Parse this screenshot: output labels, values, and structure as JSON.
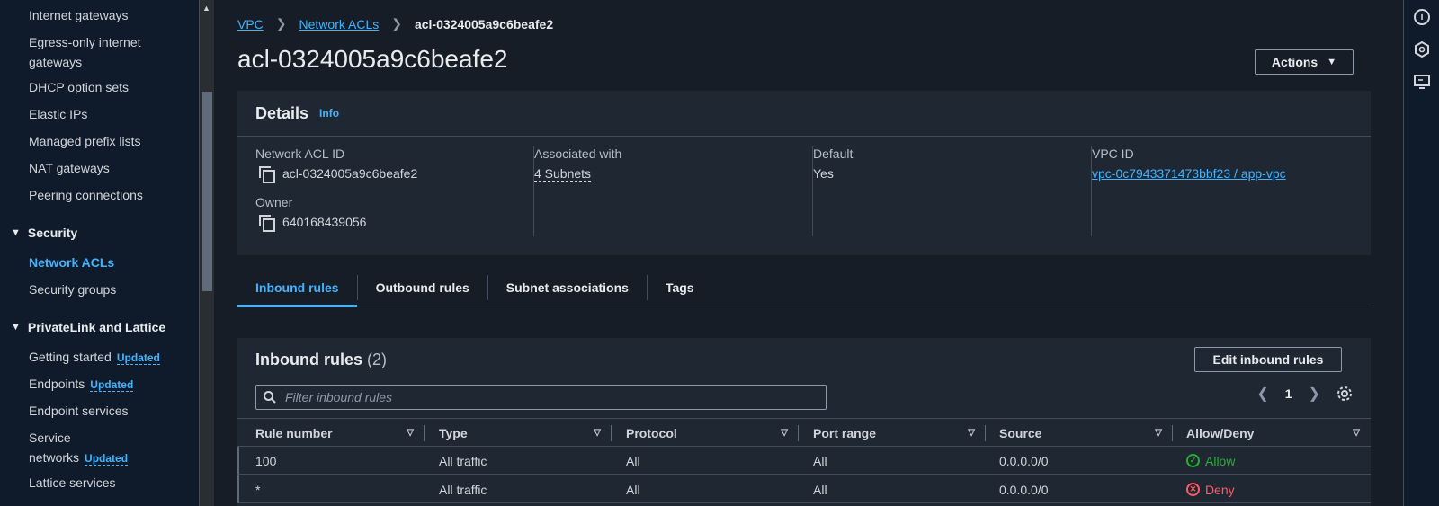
{
  "sidebar": {
    "items_top": [
      {
        "label": "Internet gateways"
      },
      {
        "label": "Egress-only internet gateways"
      },
      {
        "label": "DHCP option sets"
      },
      {
        "label": "Elastic IPs"
      },
      {
        "label": "Managed prefix lists"
      },
      {
        "label": "NAT gateways"
      },
      {
        "label": "Peering connections"
      }
    ],
    "security": {
      "label": "Security",
      "items": [
        {
          "label": "Network ACLs"
        },
        {
          "label": "Security groups"
        }
      ]
    },
    "privatelink": {
      "label": "PrivateLink and Lattice",
      "items": [
        {
          "label": "Getting started",
          "badge": "Updated"
        },
        {
          "label": "Endpoints",
          "badge": "Updated"
        },
        {
          "label": "Endpoint services"
        },
        {
          "label": "Service networks",
          "badge": "Updated"
        },
        {
          "label": "Lattice services"
        }
      ]
    }
  },
  "breadcrumb": {
    "items": [
      "VPC",
      "Network ACLs"
    ],
    "current": "acl-0324005a9c6beafe2"
  },
  "page": {
    "title": "acl-0324005a9c6beafe2",
    "actions_label": "Actions"
  },
  "details": {
    "heading": "Details",
    "info": "Info",
    "network_acl_id_label": "Network ACL ID",
    "network_acl_id": "acl-0324005a9c6beafe2",
    "owner_label": "Owner",
    "owner": "640168439056",
    "associated_label": "Associated with",
    "associated": "4 Subnets",
    "default_label": "Default",
    "default": "Yes",
    "vpc_id_label": "VPC ID",
    "vpc_id": "vpc-0c7943371473bbf23 / app-vpc"
  },
  "tabs": [
    {
      "label": "Inbound rules",
      "active": true
    },
    {
      "label": "Outbound rules"
    },
    {
      "label": "Subnet associations"
    },
    {
      "label": "Tags"
    }
  ],
  "inbound": {
    "title": "Inbound rules",
    "count": "(2)",
    "edit_label": "Edit inbound rules",
    "filter_placeholder": "Filter inbound rules",
    "page": "1",
    "columns": [
      "Rule number",
      "Type",
      "Protocol",
      "Port range",
      "Source",
      "Allow/Deny"
    ],
    "rows": [
      {
        "rule": "100",
        "type": "All traffic",
        "protocol": "All",
        "port": "All",
        "source": "0.0.0.0/0",
        "action": "Allow"
      },
      {
        "rule": "*",
        "type": "All traffic",
        "protocol": "All",
        "port": "All",
        "source": "0.0.0.0/0",
        "action": "Deny"
      }
    ]
  },
  "colors": {
    "accent": "#42b4ff",
    "allow": "#29ad32",
    "deny": "#ff5d64"
  }
}
